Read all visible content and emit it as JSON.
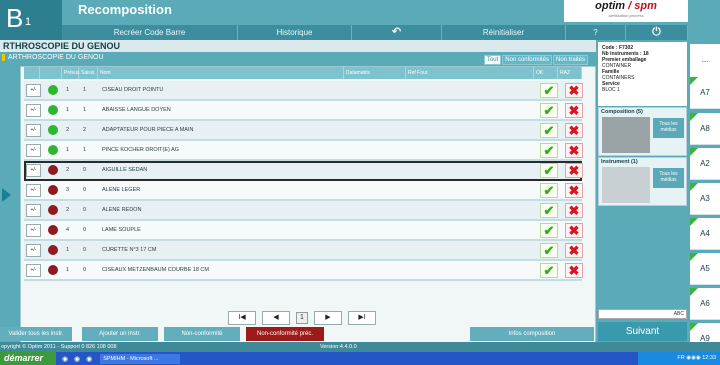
{
  "header": {
    "logo_letter": "B",
    "logo_number": "1",
    "app_title": "Recomposition",
    "brand_optim": "optim",
    "brand_sep": " / ",
    "brand_spm": "spm",
    "brand_sub": "sterilisation process",
    "nav": [
      {
        "label": "Recréer Code Barre"
      },
      {
        "label": "Historique"
      },
      {
        "label": "↶"
      },
      {
        "label": "Réinitialiser"
      },
      {
        "label": "?"
      },
      {
        "label": "⏻"
      }
    ]
  },
  "title": "RTHROSCOPIE DU GENOU",
  "subtitle": "ARTHROSCOPIE DU GENOU",
  "filters": [
    "Tout",
    "Non conformités",
    "Non traités"
  ],
  "table": {
    "columns": [
      "",
      "",
      "Prévus",
      "Saisis",
      "Nom",
      "Datamatrix",
      "Ref Four.",
      "OK",
      "RAZ"
    ],
    "rows": [
      {
        "prevus": "1",
        "saisis": "1",
        "nom": "CISEAU DROIT  POINTU",
        "status": "green"
      },
      {
        "prevus": "1",
        "saisis": "1",
        "nom": "ABAISSE LANGUE DOYEN",
        "status": "green"
      },
      {
        "prevus": "2",
        "saisis": "2",
        "nom": "ADAPTATEUR  POUR PIECE A MAIN",
        "status": "green"
      },
      {
        "prevus": "1",
        "saisis": "1",
        "nom": "PINCE KOCHER DROIT(E) AG",
        "status": "green"
      },
      {
        "prevus": "2",
        "saisis": "0",
        "nom": "AIGUILLE SEDAN",
        "status": "red",
        "selected": true
      },
      {
        "prevus": "3",
        "saisis": "0",
        "nom": "ALENE LEGER",
        "status": "red"
      },
      {
        "prevus": "2",
        "saisis": "0",
        "nom": "ALENE REDON",
        "status": "red"
      },
      {
        "prevus": "4",
        "saisis": "0",
        "nom": "LAME SOUPLE",
        "status": "red"
      },
      {
        "prevus": "1",
        "saisis": "0",
        "nom": "CURETTE N°3  17 CM",
        "status": "red"
      },
      {
        "prevus": "1",
        "saisis": "0",
        "nom": "CISEAUX METZENBAUM  COURBE 18 CM",
        "status": "red"
      }
    ],
    "pm_label": "+/-",
    "ok_glyph": "✔",
    "raz_glyph": "✖"
  },
  "pager": {
    "first": "I◀",
    "prev": "◀",
    "page": "1",
    "next": "▶",
    "last": "▶I"
  },
  "bottom_buttons": {
    "validate": "Valider tous les instr.",
    "add": "Ajouter un instr.",
    "nonconf": "Non-conformité",
    "nonconf_prec": "Non-conformité préc.",
    "infos": "Infos composition"
  },
  "info": {
    "code": "Code : F7302",
    "nb": "Nb instruments : 18",
    "premier_label": "Premier emballage",
    "premier_value": "CONTAINER",
    "famille_label": "Famille",
    "famille_value": "CONTAINERS",
    "service_label": "Service",
    "service_value": "BLOC 1"
  },
  "composition": {
    "title": "Composition (5)",
    "media": "Tous les médias"
  },
  "instrument": {
    "title": "Instrument (1)",
    "media": "Tous les médias"
  },
  "search_placeholder": "ABC",
  "suivant": "Suivant",
  "tabs": [
    "...",
    "A7",
    "A8",
    "A2",
    "A3",
    "A4",
    "A5",
    "A6",
    "A9"
  ],
  "footer": {
    "copyright": "opyright © Optim 2011 - Support 0 826 108 008",
    "version": "Version:4.4.0.0"
  },
  "taskbar": {
    "start": "démarrer",
    "task": "SPMIHM - Microsoft ...",
    "tray_lang": "FR",
    "time": "12:33"
  },
  "colors": {
    "green": "#2fb52f",
    "red": "#8e1a22",
    "accent": "#3a9aad"
  }
}
